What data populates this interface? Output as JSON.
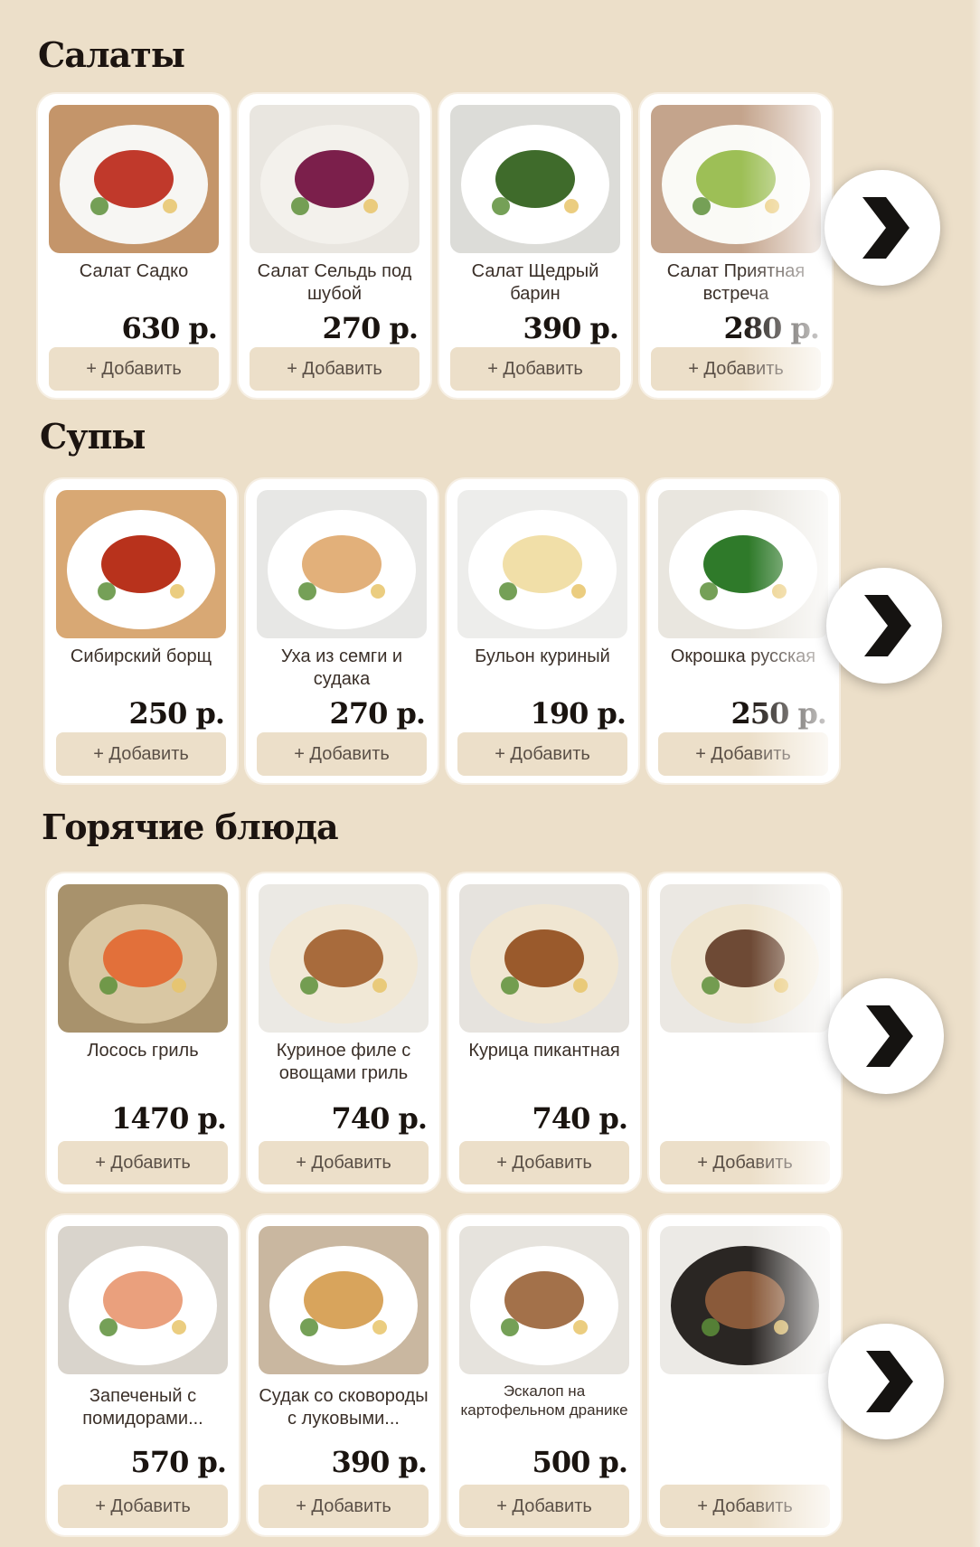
{
  "sections": [
    {
      "title": "Салаты",
      "rows": [
        {
          "items": [
            {
              "name": "Салат Садко",
              "price": "630 р.",
              "image": "salad-sadko-photo",
              "plate": "#f7f6f3",
              "accent": "#c0392b",
              "bg": "#c4956a"
            },
            {
              "name": "Салат Сельдь под шубой",
              "price": "270 р.",
              "image": "herring-salad-photo",
              "plate": "#f3f1ec",
              "accent": "#7b1f4b",
              "bg": "#e9e6e0"
            },
            {
              "name": "Салат Щедрый барин",
              "price": "390 р.",
              "image": "salad-barin-photo",
              "plate": "#ffffff",
              "accent": "#3f6b2b",
              "bg": "#dcdcd8"
            },
            {
              "name": "Салат Приятная встреча",
              "price": "280 р.",
              "image": "salad-meeting-photo",
              "plate": "#fafaf6",
              "accent": "#9dbf56",
              "bg": "#c4a48c"
            }
          ]
        }
      ]
    },
    {
      "title": "Супы",
      "rows": [
        {
          "items": [
            {
              "name": "Сибирский борщ",
              "price": "250 р.",
              "image": "borscht-photo",
              "plate": "#ffffff",
              "accent": "#b8321c",
              "bg": "#d8a874"
            },
            {
              "name": "Уха из семги и судака",
              "price": "270 р.",
              "image": "fish-soup-photo",
              "plate": "#ffffff",
              "accent": "#e2b07a",
              "bg": "#e7e7e5"
            },
            {
              "name": "Бульон куриный",
              "price": "190 р.",
              "image": "chicken-broth-photo",
              "plate": "#ffffff",
              "accent": "#f1dfa8",
              "bg": "#ededeb"
            },
            {
              "name": "Окрошка русская",
              "price": "250 р.",
              "image": "okroshka-photo",
              "plate": "#ffffff",
              "accent": "#2f7a2a",
              "bg": "#e9e6df"
            }
          ]
        }
      ]
    },
    {
      "title": "Горячие блюда",
      "rows": [
        {
          "items": [
            {
              "name": "Лосось гриль",
              "price": "1470 р.",
              "image": "grilled-salmon-photo",
              "plate": "#d9c7a3",
              "accent": "#e2703a",
              "bg": "#a8926c"
            },
            {
              "name": "Куриное филе с овощами гриль",
              "price": "740 р.",
              "image": "chicken-fillet-photo",
              "plate": "#f1e8d6",
              "accent": "#a86b3c",
              "bg": "#ebe9e4"
            },
            {
              "name": "Курица пикантная",
              "price": "740 р.",
              "image": "spicy-chicken-photo",
              "plate": "#f0e6d2",
              "accent": "#9a5a2c",
              "bg": "#e6e3de"
            },
            {
              "name": "",
              "price": "",
              "image": "grilled-meat-photo",
              "plate": "#efe5cf",
              "accent": "#6e4a35",
              "bg": "#ebe8e3"
            }
          ]
        },
        {
          "items": [
            {
              "name": "Запеченый с помидорами...",
              "price": "570 р.",
              "image": "baked-fish-photo",
              "plate": "#ffffff",
              "accent": "#eaa07d",
              "bg": "#d9d4cc"
            },
            {
              "name": "Судак со сковороды с луковыми...",
              "price": "390 р.",
              "image": "zander-photo",
              "plate": "#ffffff",
              "accent": "#d8a45c",
              "bg": "#c9b7a0"
            },
            {
              "name": "Эскалоп на картофельном дранике",
              "price": "500 р.",
              "image": "escalope-photo",
              "plate": "#ffffff",
              "accent": "#a3714a",
              "bg": "#e6e3dd"
            },
            {
              "name": "",
              "price": "",
              "image": "stir-fry-photo",
              "plate": "#2a2623",
              "accent": "#8a5a3a",
              "bg": "#eceae6"
            }
          ]
        }
      ]
    }
  ],
  "add_label": "+ Добавить",
  "next_icon": "chevron-right-icon",
  "colors": {
    "page_bg": "#ecdfc9",
    "card_bg": "#ffffff",
    "button_bg": "#ecdfc9",
    "title_text": "#1c1410"
  }
}
